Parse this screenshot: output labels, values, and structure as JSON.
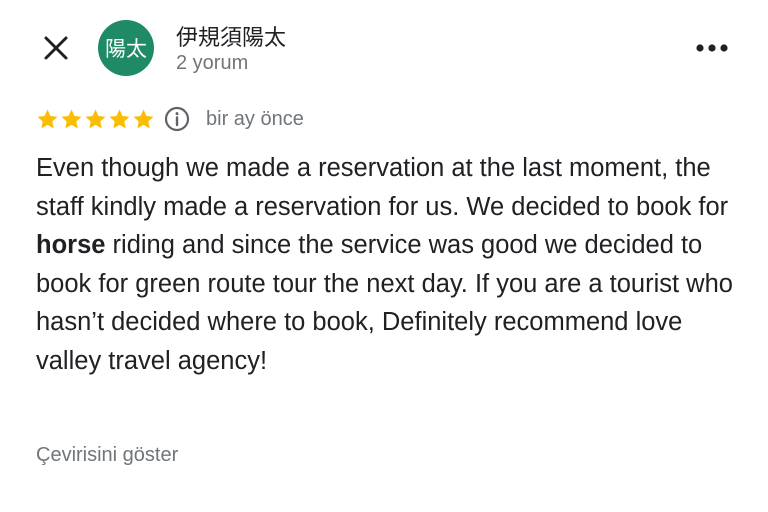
{
  "header": {
    "close_icon": "close-icon",
    "avatar_text": "陽太",
    "avatar_color": "#1e8a66",
    "author_name": "伊規須陽太",
    "review_count": "2 yorum",
    "more_icon": "more-horizontal-icon"
  },
  "review": {
    "rating": 5,
    "max_rating": 5,
    "star_color": "#fbbc04",
    "info_icon": "info-icon",
    "time_ago": "bir ay önce",
    "text_parts": {
      "before_highlight": "Even though we made a reservation at the last moment, the staff kindly made a reservation for us. We decided to book for ",
      "highlight": "horse",
      "after_highlight": " riding and since the service was good we decided to book for green route tour the next day. If you are a tourist who hasn’t decided where to book, Definitely recommend love valley travel agency!"
    }
  },
  "footer": {
    "translate_label": "Çevirisini göster"
  }
}
